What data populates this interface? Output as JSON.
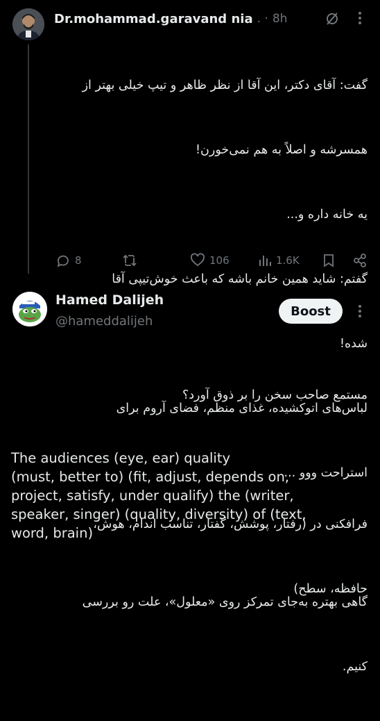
{
  "post1": {
    "author": "Dr.mohammad.garavand nia",
    "separator": ". ·",
    "time": "8h",
    "lines": [
      "گفت: آقای دکتر، این آقا از نظر ظاهر و تیپ خیلی بهتر از",
      "همسرشه و اصلاً به هم نمی‌خورن!",
      "یه خانه داره و...",
      "گفتم: شاید همین خانم باشه که باعث خوش‌تیپی آقا",
      "شده!",
      "لباس‌های اتوکشیده، غذای منظم، فضای آروم برای",
      "استراحت ووو ...",
      "",
      "گاهی بهتره به‌جای تمرکز روی «معلول»، علت رو بررسی",
      "کنیم."
    ],
    "actions": {
      "replies": "8",
      "likes": "106",
      "views": "1.6K"
    }
  },
  "post2": {
    "author": "Hamed Dalijeh",
    "handle": "@hameddalijeh",
    "boost_label": "Boost",
    "lines_fa": [
      "مستمع صاحب سخن را بر ذوق آورد؟",
      "",
      "فرافکنی در (رفتار، پوشش، گفتار، تناسب اندام، هوش،",
      "حافظه، سطح)"
    ],
    "lines_en": [
      "The audiences (eye, ear) quality",
      "(must, better to) (fit, adjust, depends on,",
      "project, satisfy, under qualify) the (writer,",
      "speaker, singer) (quality, diversity) of (text,",
      "word, brain)"
    ]
  },
  "colors": {
    "background": "#000000",
    "text": "#e7e9ea",
    "muted": "#71767b",
    "button": "#eff3f4"
  }
}
